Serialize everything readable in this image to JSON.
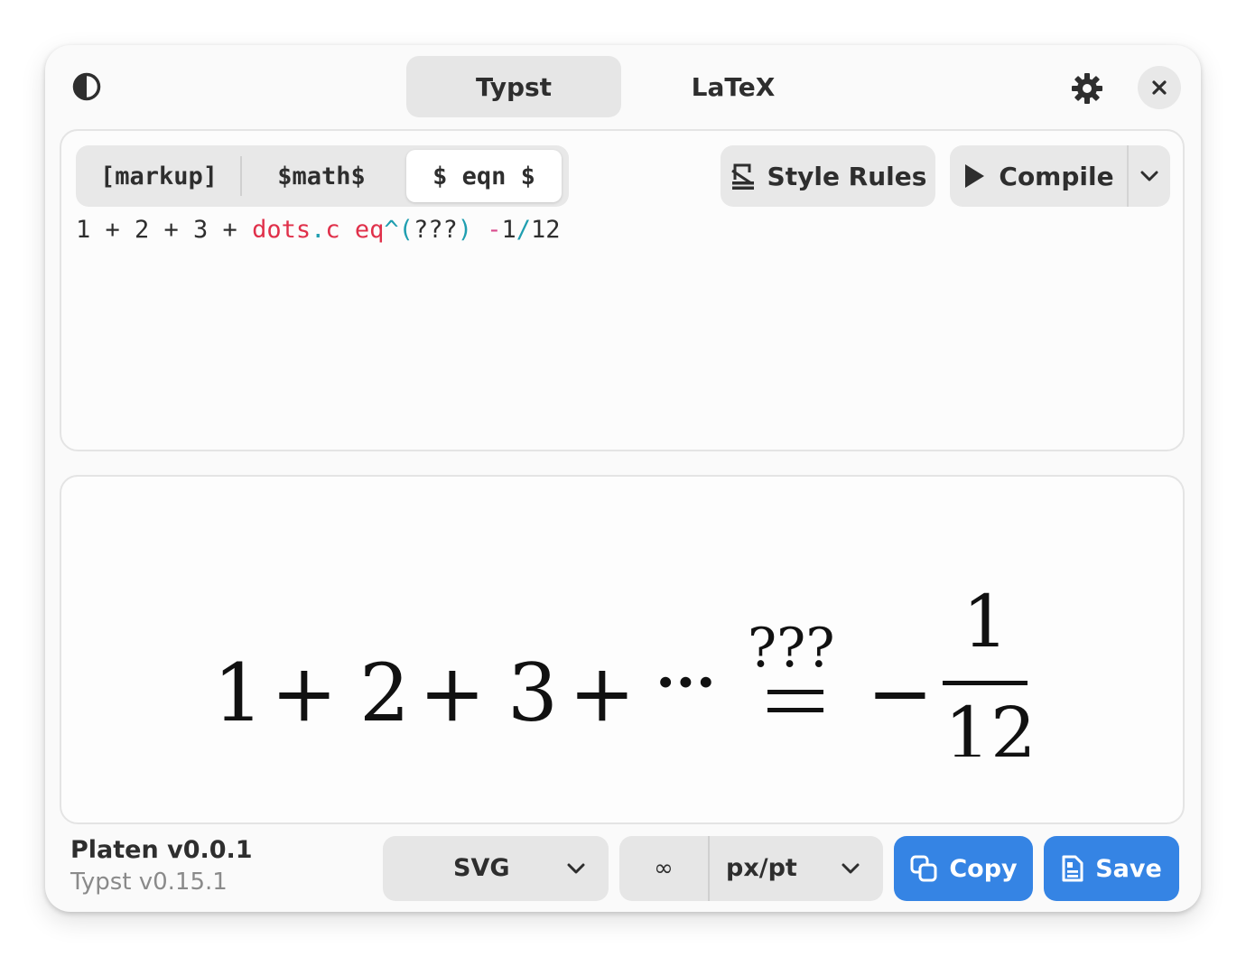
{
  "header": {
    "tabs": [
      {
        "label": "Typst",
        "active": true
      },
      {
        "label": "LaTeX",
        "active": false
      }
    ]
  },
  "editor": {
    "modes": [
      {
        "label": "[markup]",
        "active": false
      },
      {
        "label": "$math$",
        "active": false
      },
      {
        "label": "$ eqn $",
        "active": true
      }
    ],
    "style_rules_label": "Style Rules",
    "compile_label": "Compile",
    "code": {
      "plain1": "1 + 2 + 3 + ",
      "fn1": "dots",
      "op1": ".",
      "fn2": "c",
      "sp1": " ",
      "fn3": "eq",
      "op2": "^(",
      "plain2": "???",
      "op3": ")",
      "sp2": " ",
      "neg": "-",
      "num1": "1",
      "op4": "/",
      "num2": "12"
    }
  },
  "preview": {
    "expression": {
      "terms": [
        "1",
        "+",
        "2",
        "+",
        "3",
        "+",
        "···"
      ],
      "eq_top": "???",
      "minus": "−",
      "numerator": "1",
      "denominator": "12"
    }
  },
  "footer": {
    "app_name": "Platen v0.0.1",
    "engine_version": "Typst v0.15.1",
    "format": "SVG",
    "scale": "∞",
    "unit": "px/pt",
    "copy_label": "Copy",
    "save_label": "Save"
  },
  "colors": {
    "accent": "#3584e4",
    "code_function": "#e0304a",
    "code_operator": "#1f9eb0",
    "code_negative": "#d94b8d"
  }
}
